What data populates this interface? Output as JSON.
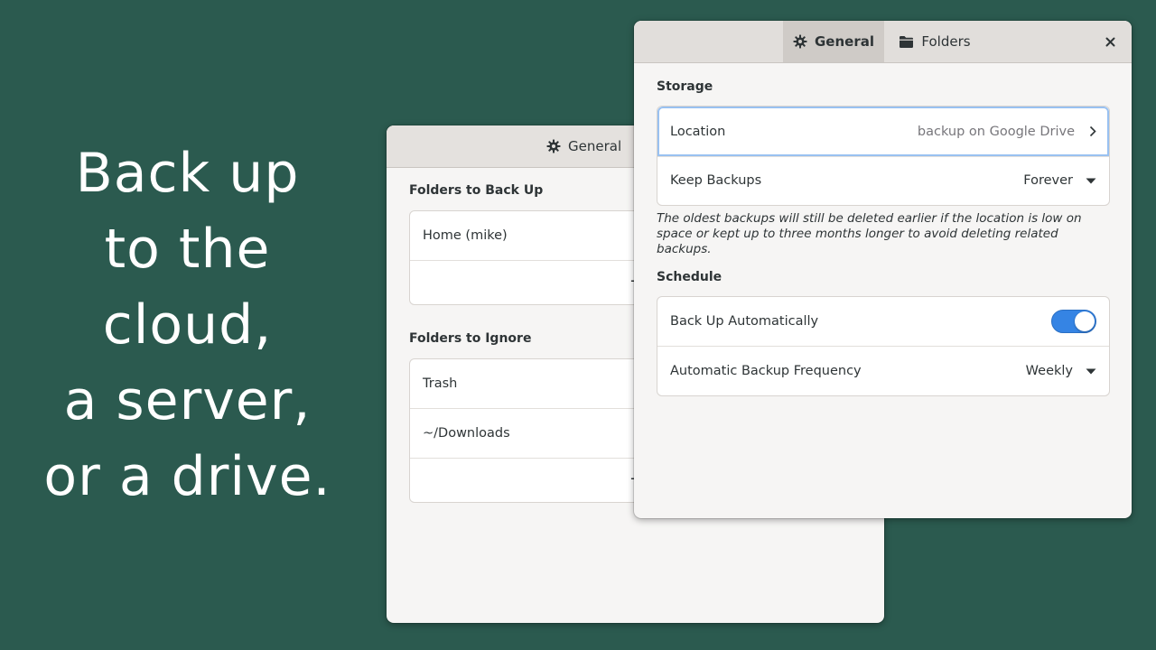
{
  "tagline": {
    "lines": [
      "Back up",
      "to the",
      "cloud,",
      "a server,",
      "or a drive."
    ]
  },
  "back_window": {
    "tab_general": "General",
    "folders_to_back_up": {
      "title": "Folders to Back Up",
      "items": [
        "Home (mike)"
      ]
    },
    "folders_to_ignore": {
      "title": "Folders to Ignore",
      "items": [
        "Trash",
        "~/Downloads"
      ]
    }
  },
  "front_window": {
    "tabs": [
      {
        "label": "General",
        "icon": "gear-icon",
        "active": true
      },
      {
        "label": "Folders",
        "icon": "folder-icon",
        "active": false
      }
    ],
    "storage": {
      "title": "Storage",
      "location_label": "Location",
      "location_value": "backup on Google Drive",
      "keep_label": "Keep Backups",
      "keep_value": "Forever",
      "note": "The oldest backups will still be deleted earlier if the location is low on space or kept up to three months longer to avoid deleting related backups."
    },
    "schedule": {
      "title": "Schedule",
      "auto_label": "Back Up Automatically",
      "auto_enabled": true,
      "frequency_label": "Automatic Backup Frequency",
      "frequency_value": "Weekly"
    }
  },
  "colors": {
    "background": "#2b5a4f",
    "accent": "#3584e4",
    "focus_ring": "#99c1f1"
  }
}
